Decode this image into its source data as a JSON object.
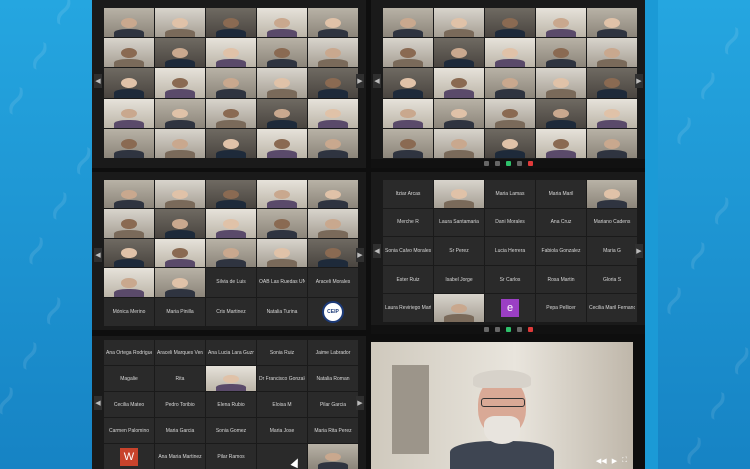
{
  "colors": {
    "background": "#1b9ad6",
    "tile": "#2a2a2a",
    "toolbar_active": "#2ec16b",
    "toolbar_alert": "#e03a3a"
  },
  "icons": [
    "arrow-left-icon",
    "arrow-right-icon",
    "video-icon",
    "mic-icon",
    "share-icon",
    "play-icon",
    "fullscreen-icon"
  ],
  "windows": {
    "top_left": {
      "arrow_left": "◀",
      "arrow_right": "▶"
    },
    "top_right": {
      "arrow_left": "◀",
      "arrow_right": "▶"
    },
    "mid_left": {
      "arrow_left": "◀",
      "arrow_right": "▶",
      "names": [
        "Silvia de Luis",
        "OAB Las Ruedas UNED",
        "Araceli Morales",
        "Mónica Merino",
        "Maria Pinilla",
        "Cris Martinez",
        "Natalia Turina",
        "Laura Fernandez"
      ],
      "logo_text": "CEIP"
    },
    "mid_right": {
      "arrow_left": "◀",
      "arrow_right": "▶",
      "names": [
        "Itziar Arcas",
        "Maria Lamas",
        "Maria Maril",
        "Merche R",
        "Laura Santamaria",
        "Dani Morales",
        "Ana Cruz",
        "Mariano Cadens",
        "Sonia Calvo Morales",
        "Sr Perez",
        "Lucia Herrera",
        "Fabiola Gonzalez",
        "Maria G",
        "Ester Ruiz",
        "Isabel Jorge",
        "Sr Carlos",
        "Rosa Martin",
        "Gloria S",
        "Laura Reviriego Martín",
        "Pepa Pellicer",
        "Cecilia Maril Fernandez"
      ],
      "avatar_letter": "e"
    },
    "bottom_left": {
      "arrow_left": "◀",
      "arrow_right": "▶",
      "names": [
        "Ana Ortega Rodriguez",
        "Araceli Marques Vera",
        "Ana Lucia Lara Guzman",
        "Sonia Ruiz",
        "Jaime Labrador",
        "Magalie",
        "Rita",
        "Dr Francisco Gonzalo",
        "Natalia Roman",
        "Cecilia Mateo",
        "Pedro Toribio",
        "Elena Rubio",
        "Eloisa M",
        "Pilar Garcia",
        "Carmen Palomino",
        "Maria Garcia",
        "Sonia Gomez",
        "Maria Jose",
        "Maria Rita Perez",
        "Ana Maria Martinez",
        "Pilar Ramos"
      ],
      "avatar_letter": "W"
    },
    "speaker": {
      "play": "▶",
      "fullscreen": "⛶",
      "counter": "◀◀"
    }
  }
}
